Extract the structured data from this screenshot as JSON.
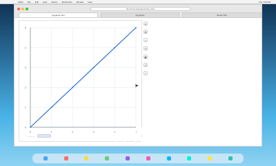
{
  "os": {
    "menu": [
      "Safari",
      "File",
      "Edit",
      "View",
      "History",
      "Bookmarks",
      "Window",
      "Help"
    ],
    "status": "Thu 7:02 AM"
  },
  "browser": {
    "address": "file:///Users/desktop/index.html",
    "tabs": [
      {
        "label": "dygraphs.html",
        "active": true
      },
      {
        "label": "Dygraphs",
        "active": false
      },
      {
        "label": "Bokeh Plot",
        "active": false
      }
    ]
  },
  "chart_data": {
    "type": "line",
    "title": "",
    "xlabel": "",
    "ylabel": "",
    "series": [
      {
        "values": [
          0,
          1,
          2,
          3,
          4,
          5
        ]
      }
    ],
    "x": [
      0,
      1,
      2,
      3,
      4,
      5
    ],
    "xlim": [
      0,
      5
    ],
    "ylim": [
      0,
      5
    ],
    "y_ticks": [
      "5",
      "4",
      "3",
      "2",
      "1",
      "0"
    ],
    "x_ticks": [
      "0",
      "1",
      "2",
      "3",
      "4",
      "5"
    ],
    "grid": true,
    "line_color": "#2a6fd1"
  },
  "toolbar": {
    "icons": [
      "bokeh-logo-icon",
      "pan-icon",
      "zoom-icon",
      "wheel-zoom-icon",
      "save-icon",
      "reset-icon",
      "help-icon"
    ]
  },
  "watermark": {
    "line1": "Mind",
    "line2": "Luster"
  }
}
